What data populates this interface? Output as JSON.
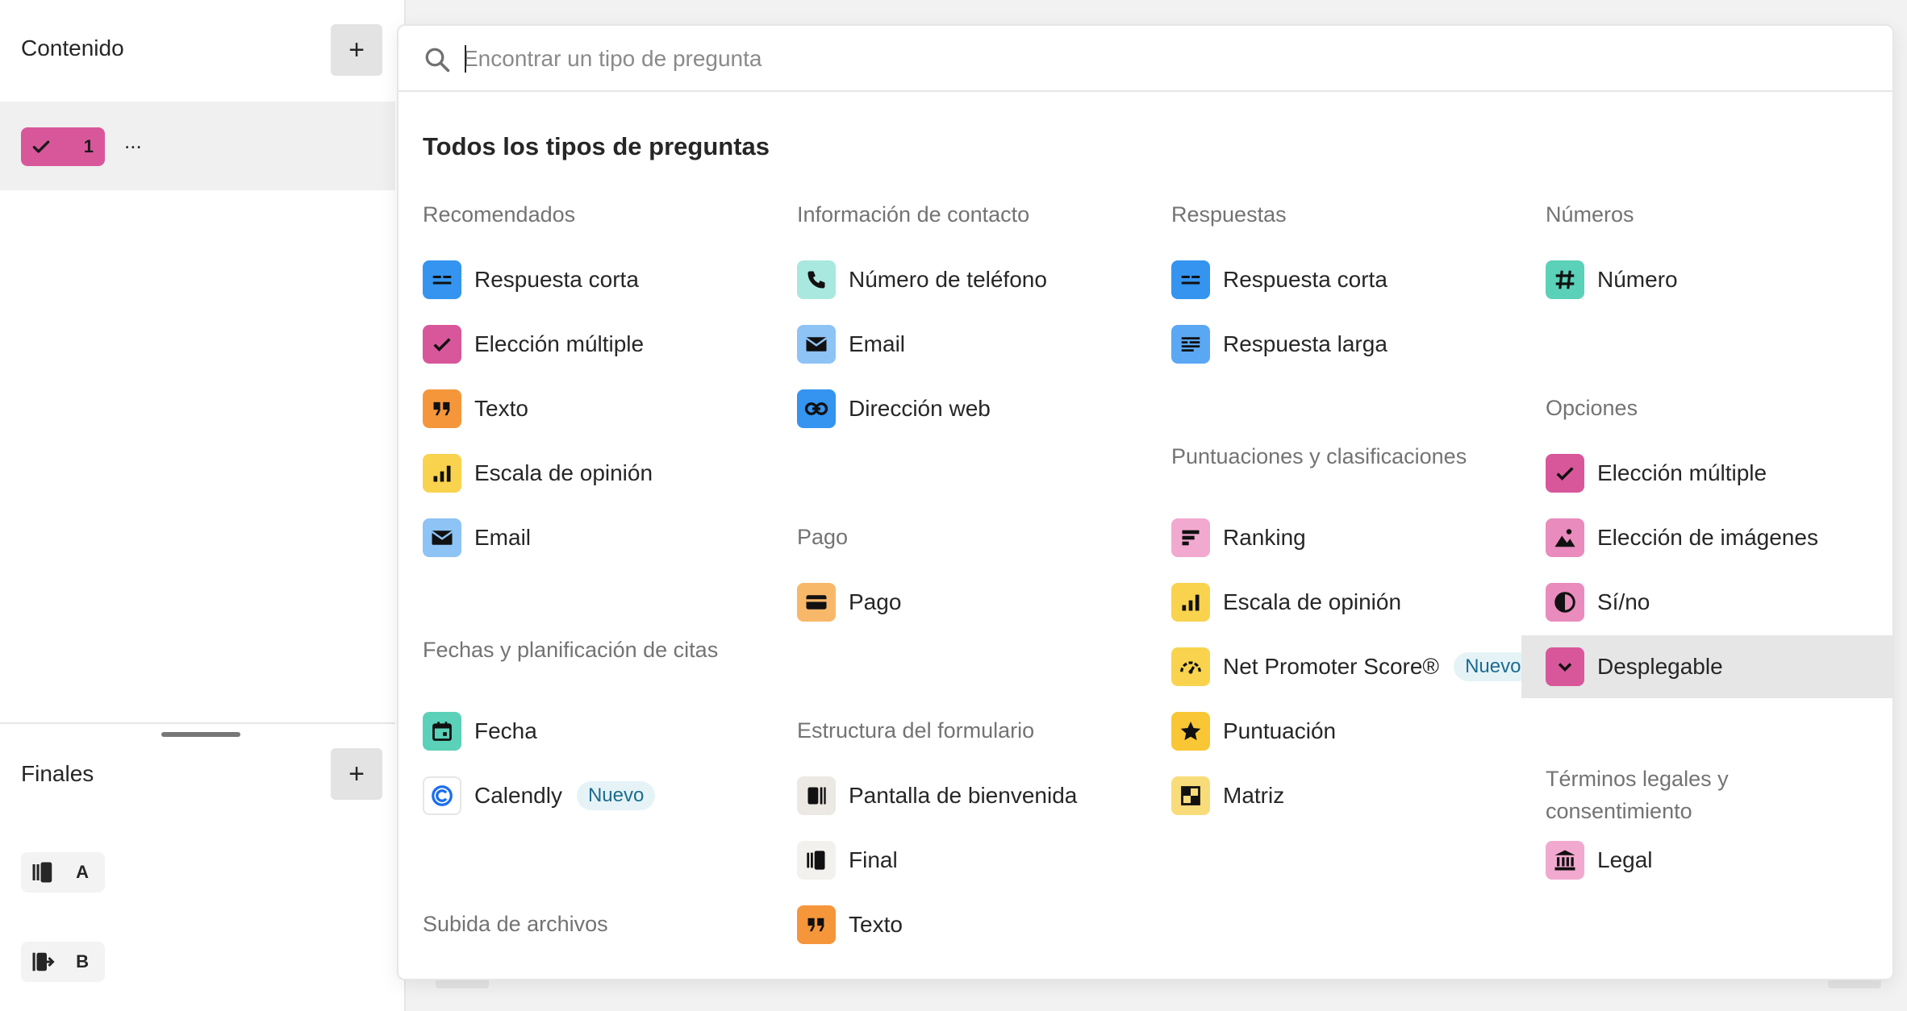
{
  "sidebar": {
    "content_title": "Contenido",
    "add_symbol": "+",
    "question_number": "1",
    "question_more": "...",
    "endings_title": "Finales",
    "endings": [
      {
        "label": "A"
      },
      {
        "label": "B"
      }
    ]
  },
  "search": {
    "placeholder": "Encontrar un tipo de pregunta",
    "value": ""
  },
  "popup_title": "Todos los tipos de preguntas",
  "colors": {
    "pink": "#d8579b",
    "blue": "#3494f0",
    "orange": "#f5963b",
    "yellow": "#f9d34e",
    "teal": "#5ad1b8",
    "tag_bg": "#e5f3f7"
  },
  "sections": {
    "recomendados": {
      "title": "Recomendados",
      "items": [
        {
          "label": "Respuesta corta",
          "icon": "short-text-icon"
        },
        {
          "label": "Elección múltiple",
          "icon": "check-icon"
        },
        {
          "label": "Texto",
          "icon": "quote-icon"
        },
        {
          "label": "Escala de opinión",
          "icon": "bar-chart-icon"
        },
        {
          "label": "Email",
          "icon": "mail-icon"
        }
      ]
    },
    "fechas": {
      "title": "Fechas y planificación de citas",
      "items": [
        {
          "label": "Fecha",
          "icon": "calendar-icon"
        },
        {
          "label": "Calendly",
          "icon": "calendly-icon",
          "tag": "Nuevo"
        }
      ]
    },
    "subida": {
      "title": "Subida de archivos"
    },
    "contacto": {
      "title": "Información de contacto",
      "items": [
        {
          "label": "Número de teléfono",
          "icon": "phone-icon"
        },
        {
          "label": "Email",
          "icon": "mail-icon"
        },
        {
          "label": "Dirección web",
          "icon": "link-icon"
        }
      ]
    },
    "pago": {
      "title": "Pago",
      "items": [
        {
          "label": "Pago",
          "icon": "card-icon"
        }
      ]
    },
    "estructura": {
      "title": "Estructura del formulario",
      "items": [
        {
          "label": "Pantalla de bienvenida",
          "icon": "welcome-screen-icon"
        },
        {
          "label": "Final",
          "icon": "ending-icon"
        },
        {
          "label": "Texto",
          "icon": "quote-icon"
        }
      ]
    },
    "respuestas": {
      "title": "Respuestas",
      "items": [
        {
          "label": "Respuesta corta",
          "icon": "short-text-icon"
        },
        {
          "label": "Respuesta larga",
          "icon": "long-text-icon"
        }
      ]
    },
    "puntuaciones": {
      "title": "Puntuaciones y clasificaciones",
      "items": [
        {
          "label": "Ranking",
          "icon": "ranking-icon"
        },
        {
          "label": "Escala de opinión",
          "icon": "bar-chart-icon"
        },
        {
          "label": "Net Promoter Score®",
          "icon": "gauge-icon",
          "tag": "Nuevo"
        },
        {
          "label": "Puntuación",
          "icon": "star-icon"
        },
        {
          "label": "Matriz",
          "icon": "matrix-icon"
        }
      ]
    },
    "numeros": {
      "title": "Números",
      "items": [
        {
          "label": "Número",
          "icon": "hash-icon"
        }
      ]
    },
    "opciones": {
      "title": "Opciones",
      "items": [
        {
          "label": "Elección múltiple",
          "icon": "check-icon"
        },
        {
          "label": "Elección de imágenes",
          "icon": "image-icon"
        },
        {
          "label": "Sí/no",
          "icon": "yes-no-icon"
        },
        {
          "label": "Desplegable",
          "icon": "dropdown-icon",
          "highlighted": true
        }
      ]
    },
    "legales": {
      "title": "Términos legales y consentimiento",
      "items": [
        {
          "label": "Legal",
          "icon": "bank-icon"
        }
      ]
    }
  }
}
